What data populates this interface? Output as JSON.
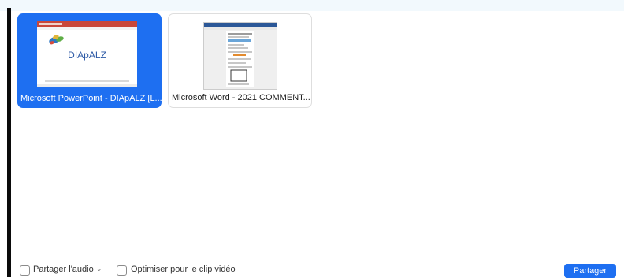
{
  "windows": [
    {
      "title": "Microsoft PowerPoint - DIApALZ [L...",
      "selected": true,
      "thumbnail_text": "DIApALZ"
    },
    {
      "title": "Microsoft Word - 2021 COMMENT...",
      "selected": false
    }
  ],
  "footer": {
    "share_audio_label": "Partager l'audio",
    "optimize_video_label": "Optimiser pour le clip vidéo",
    "share_button_label": "Partager"
  },
  "colors": {
    "accent": "#1e6ff1"
  }
}
